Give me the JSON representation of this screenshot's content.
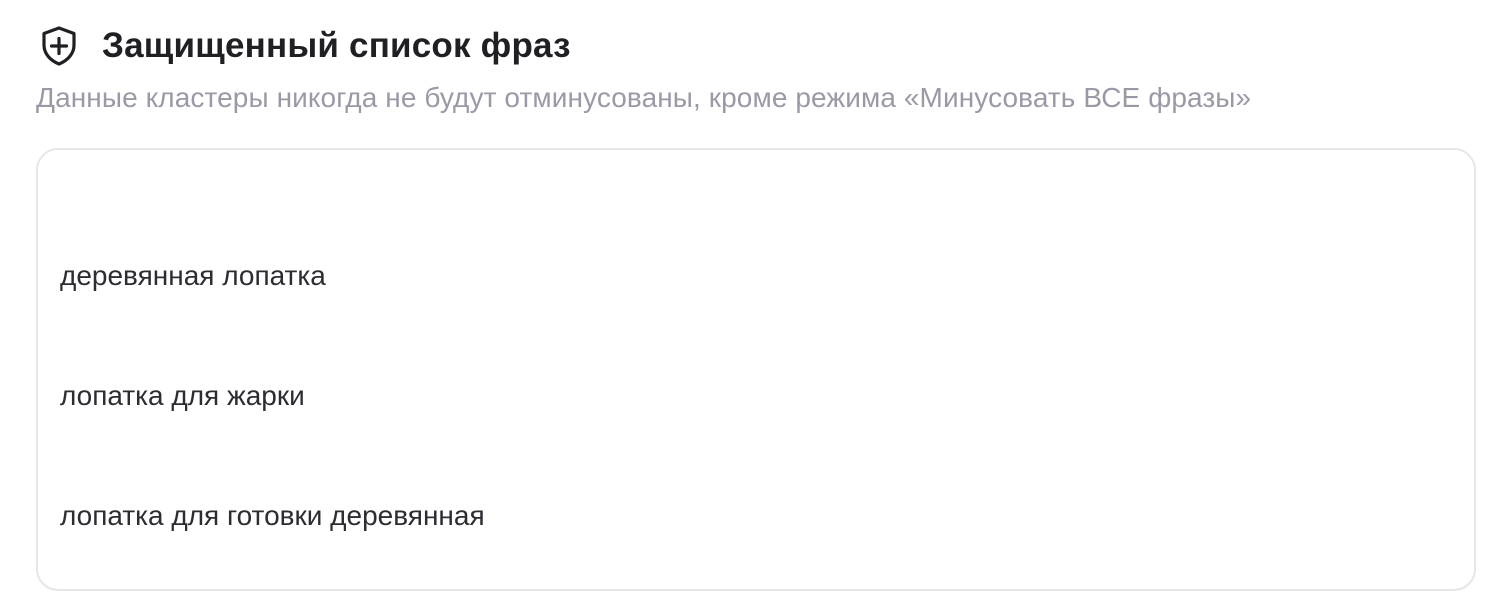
{
  "section": {
    "icon": "shield-plus-icon",
    "title": "Защищенный список фраз",
    "subtitle": "Данные кластеры никогда не будут отминусованы, кроме режима «Минусовать ВСЕ фразы»"
  },
  "phrases": {
    "lines": [
      "деревянная лопатка",
      "лопатка для жарки",
      "лопатка для готовки деревянная"
    ]
  },
  "colors": {
    "title": "#1f1f24",
    "subtitle": "#9a9aa6",
    "border": "#e6e6ea"
  }
}
